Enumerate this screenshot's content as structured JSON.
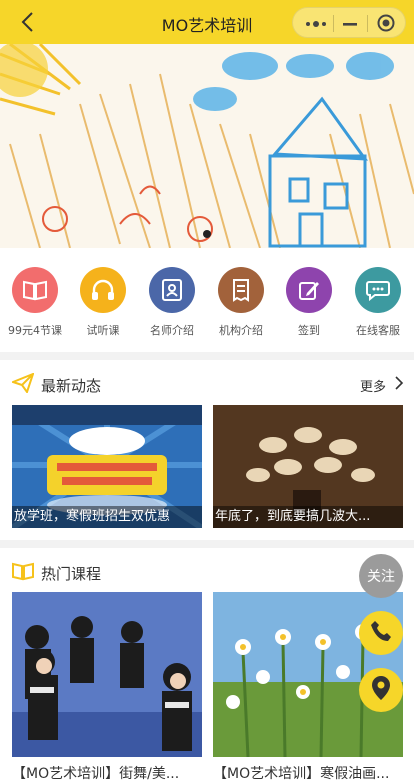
{
  "header": {
    "title": "MO艺术培训"
  },
  "menu": [
    {
      "label": "99元4节课",
      "color": "#f26d6d",
      "icon": "book-icon"
    },
    {
      "label": "试听课",
      "color": "#f5b21b",
      "icon": "headphones-icon"
    },
    {
      "label": "名师介绍",
      "color": "#4b67a8",
      "icon": "teacher-icon"
    },
    {
      "label": "机构介绍",
      "color": "#a2623b",
      "icon": "document-icon"
    },
    {
      "label": "签到",
      "color": "#8e44ad",
      "icon": "edit-icon"
    },
    {
      "label": "在线客服",
      "color": "#3d9aa0",
      "icon": "chat-icon"
    }
  ],
  "news": {
    "title": "最新动态",
    "more": "更多",
    "items": [
      {
        "caption": "放学班，寒假班招生双优惠"
      },
      {
        "caption": "年底了，到底要搞几波大..."
      }
    ]
  },
  "courses": {
    "title": "热门课程",
    "items": [
      {
        "title": "【MO艺术培训】街舞/美..."
      },
      {
        "title": "【MO艺术培训】寒假油画..."
      }
    ]
  },
  "floating": {
    "follow": "关注"
  },
  "colors": {
    "brand": "#f6d629"
  }
}
